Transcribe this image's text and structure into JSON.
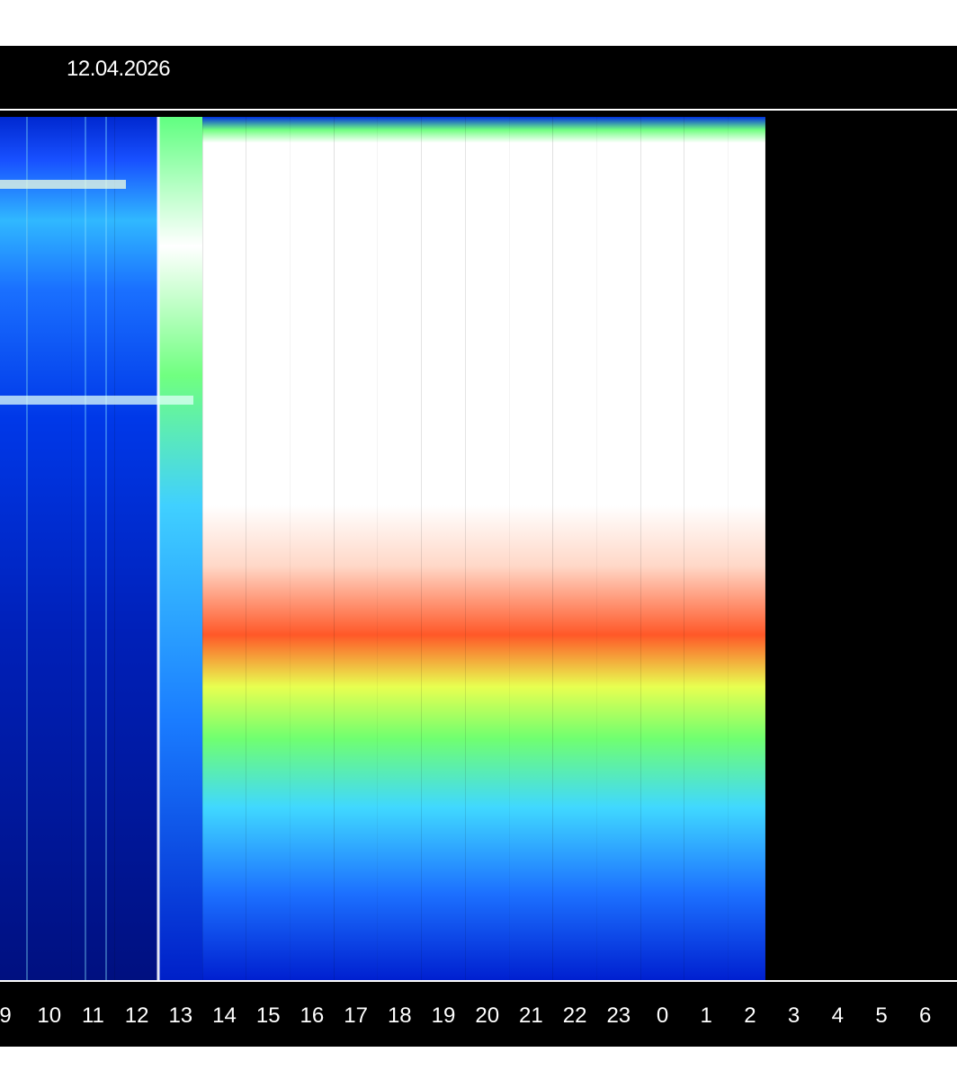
{
  "date": "12.04.2026",
  "chart_data": {
    "type": "heatmap",
    "title": "",
    "xlabel": "",
    "ylabel": "",
    "x_ticks": [
      "9",
      "10",
      "11",
      "12",
      "13",
      "14",
      "15",
      "16",
      "17",
      "18",
      "19",
      "20",
      "21",
      "22",
      "23",
      "0",
      "1",
      "2",
      "3",
      "4",
      "5",
      "6"
    ],
    "data_end_hour": 2.35,
    "colorscale": [
      "#000060",
      "#0018c8",
      "#1060ff",
      "#30c8ff",
      "#60ff80",
      "#ffff40",
      "#ff4020",
      "#ffffff"
    ],
    "intensity_by_hour": [
      {
        "hour": 9,
        "level": 0.15
      },
      {
        "hour": 10,
        "level": 0.18
      },
      {
        "hour": 11,
        "level": 0.2
      },
      {
        "hour": 12,
        "level": 0.3
      },
      {
        "hour": 13,
        "level": 0.4
      },
      {
        "hour": 14,
        "level": 0.85
      },
      {
        "hour": 15,
        "level": 0.85
      },
      {
        "hour": 16,
        "level": 0.88
      },
      {
        "hour": 17,
        "level": 0.8
      },
      {
        "hour": 18,
        "level": 0.82
      },
      {
        "hour": 19,
        "level": 0.8
      },
      {
        "hour": 20,
        "level": 0.78
      },
      {
        "hour": 21,
        "level": 0.76
      },
      {
        "hour": 22,
        "level": 0.76
      },
      {
        "hour": 23,
        "level": 0.75
      },
      {
        "hour": 0,
        "level": 0.74
      },
      {
        "hour": 1,
        "level": 0.74
      },
      {
        "hour": 2,
        "level": 0.74
      }
    ]
  }
}
